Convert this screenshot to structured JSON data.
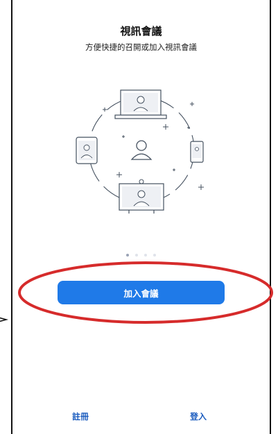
{
  "header": {
    "title": "視訊會議",
    "subtitle": "方便快捷的召開或加入視訊會議"
  },
  "illustration": {
    "icon": "video-meeting-devices-icon"
  },
  "carousel": {
    "page_count": 4,
    "active_index": 0
  },
  "actions": {
    "join_label": "加入會議",
    "signup_label": "註冊",
    "login_label": "登入"
  },
  "colors": {
    "primary": "#1f7ae8",
    "link": "#1b5cbf",
    "annotation": "#d62b2b"
  }
}
